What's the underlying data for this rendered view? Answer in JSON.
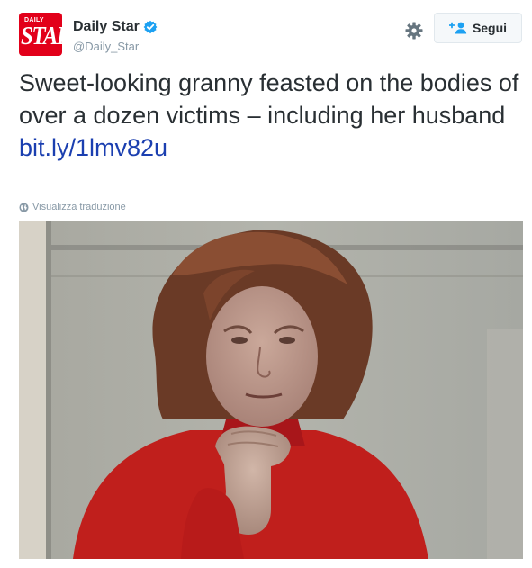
{
  "account": {
    "display_name": "Daily Star",
    "handle": "@Daily_Star",
    "avatar_text_top": "DAILY",
    "avatar_text_main": "STAR",
    "verified": true
  },
  "actions": {
    "follow_label": "Segui"
  },
  "tweet": {
    "text": "Sweet-looking granny feasted on the bodies of over a dozen victims – including her husband",
    "link": "bit.ly/1lmv82u",
    "translate_label": "Visualizza traduzione"
  },
  "colors": {
    "brand_red": "#e2001a",
    "link_blue": "#1b3fb0",
    "verified_blue": "#1da1f2",
    "follow_accent": "#1da1f2"
  },
  "icons": [
    "verified-badge-icon",
    "gear-icon",
    "follow-user-plus-icon",
    "globe-icon"
  ]
}
